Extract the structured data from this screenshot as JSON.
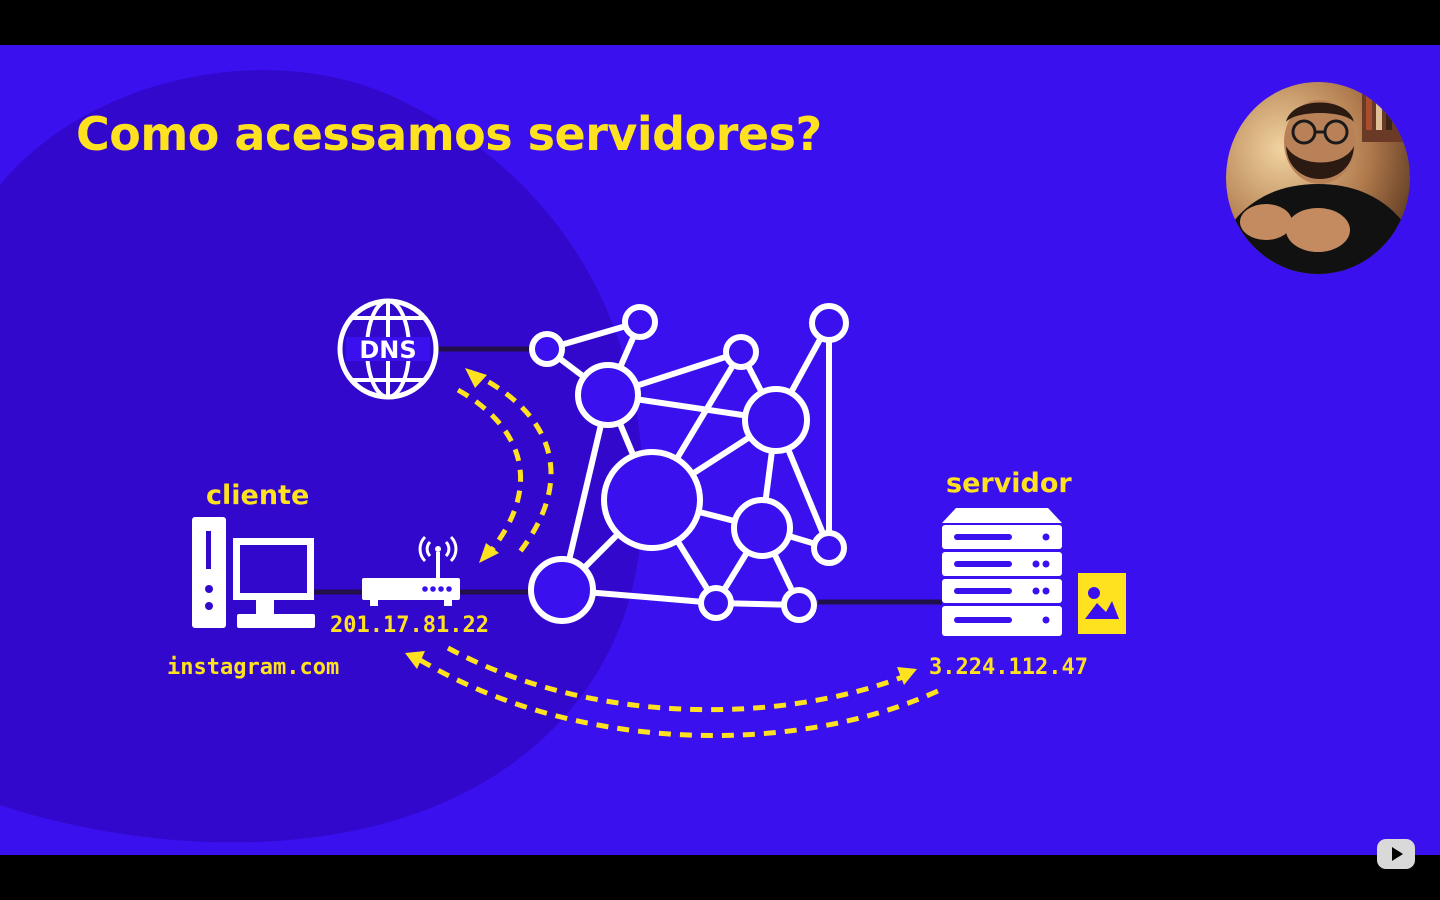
{
  "slide": {
    "title": "Como acessamos servidores?",
    "labels": {
      "client": "cliente",
      "server": "servidor",
      "dns": "DNS",
      "client_domain": "instagram.com",
      "router_ip": "201.17.81.22",
      "server_ip": "3.224.112.47"
    }
  },
  "colors": {
    "background": "#3a10ee",
    "blob": "#3208cc",
    "accent": "#ffe21f",
    "icon": "#ffffff",
    "link": "#22104a"
  },
  "icons": {
    "dns": "globe-icon",
    "client": "desktop-computer-icon",
    "router": "router-icon",
    "network": "network-graph-icon",
    "server": "server-rack-icon",
    "file": "image-file-icon",
    "presenter": "webcam-presenter",
    "player": "play-button-icon"
  }
}
